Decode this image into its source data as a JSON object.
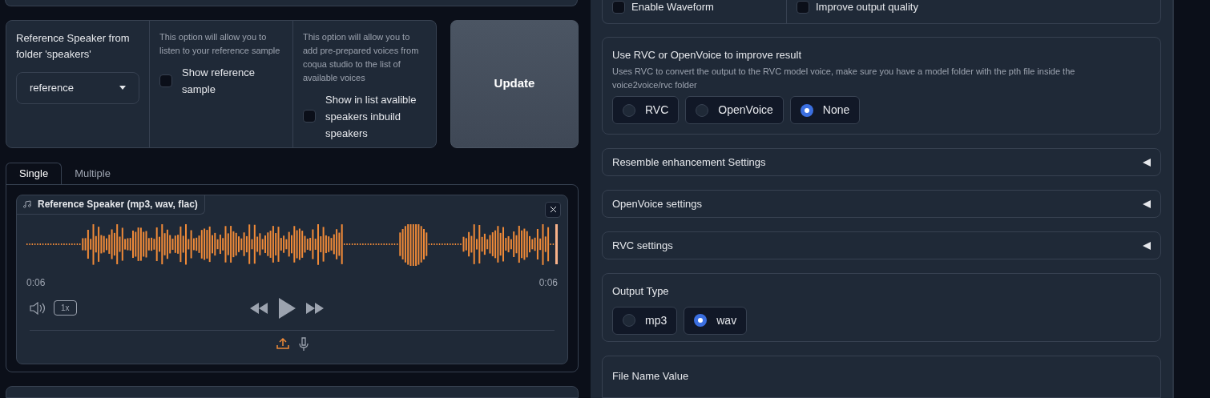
{
  "top_partial": {
    "options": [
      {
        "label": "Enable Waveform",
        "checked": false
      },
      {
        "label": "Improve output quality",
        "checked": false
      }
    ]
  },
  "speaker": {
    "label": "Reference Speaker from folder 'speakers'",
    "value": "reference"
  },
  "show_reference": {
    "info": "This option will allow you to listen to your reference sample",
    "label": "Show reference sample",
    "checked": false
  },
  "show_inbuilt": {
    "info": "This option will allow you to add pre-prepared voices from coqua studio to the list of available voices",
    "label": "Show in list avalible speakers inbuild speakers",
    "checked": false
  },
  "update_button": "Update",
  "tabs": [
    {
      "label": "Single",
      "selected": true
    },
    {
      "label": "Multiple",
      "selected": false
    }
  ],
  "audio": {
    "label": "Reference Speaker (mp3, wav, flac)",
    "current_time": "0:06",
    "duration": "0:06",
    "speed": "1x"
  },
  "rvc": {
    "label": "Use RVC or OpenVoice to improve result",
    "info": "Uses RVC to convert the output to the RVC model voice, make sure you have a model folder with the pth file inside the voice2voice/rvc folder",
    "options": [
      {
        "label": "RVC",
        "selected": false
      },
      {
        "label": "OpenVoice",
        "selected": false
      },
      {
        "label": "None",
        "selected": true
      }
    ]
  },
  "accordions": [
    {
      "label": "Resemble enhancement Settings",
      "expanded": false
    },
    {
      "label": "OpenVoice settings",
      "expanded": false
    },
    {
      "label": "RVC settings",
      "expanded": false
    }
  ],
  "output_type": {
    "label": "Output Type",
    "options": [
      {
        "label": "mp3",
        "selected": false
      },
      {
        "label": "wav",
        "selected": true
      }
    ]
  },
  "file_name": {
    "label": "File Name Value"
  }
}
